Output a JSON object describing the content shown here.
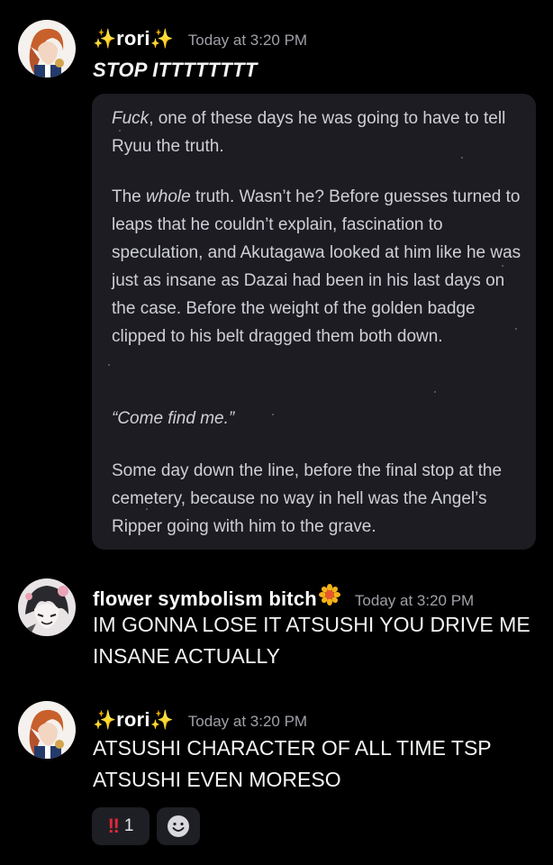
{
  "messages": [
    {
      "username": "rori",
      "sparkle_left": "✨",
      "sparkle_right": "✨",
      "timestamp": "Today at 3:20 PM",
      "text": "STOP ITTTTTTTT",
      "quote": {
        "p1_em": "Fuck",
        "p1_rest": ", one of these days he was going to have to tell Ryuu the truth.",
        "p2_a": "The ",
        "p2_em": "whole",
        "p2_b": " truth. Wasn’t he? Before guesses turned to leaps that he couldn’t explain, fascination to speculation, and Akutagawa looked at him like he was just as insane as Dazai had been in his last days on the case. Before the weight of the golden badge clipped to his belt dragged them both down.",
        "p3_em": "“Come find me.”",
        "p4": "Some day down the line, before the final stop at the cemetery, because no way in hell was the Angel’s Ripper going with him to the grave."
      }
    },
    {
      "username": "flower symbolism bitch",
      "badge_icon": "sunflower-icon",
      "timestamp": "Today at 3:20 PM",
      "text": "IM GONNA LOSE IT ATSUSHI YOU DRIVE ME INSANE ACTUALLY"
    },
    {
      "username": "rori",
      "sparkle_left": "✨",
      "sparkle_right": "✨",
      "timestamp": "Today at 3:20 PM",
      "text": "ATSUSHI CHARACTER OF ALL TIME TSP ATSUSHI EVEN MORESO",
      "reactions": [
        {
          "emoji": "‼",
          "icon": "double-exclamation-icon",
          "count": "1"
        },
        {
          "icon": "add-reaction-icon"
        }
      ]
    }
  ],
  "colors": {
    "background": "#000000",
    "card": "#1c1c22",
    "timestamp": "#a0a0a8",
    "reaction_bg": "#1e1f24",
    "exclaim": "#e0283a"
  }
}
